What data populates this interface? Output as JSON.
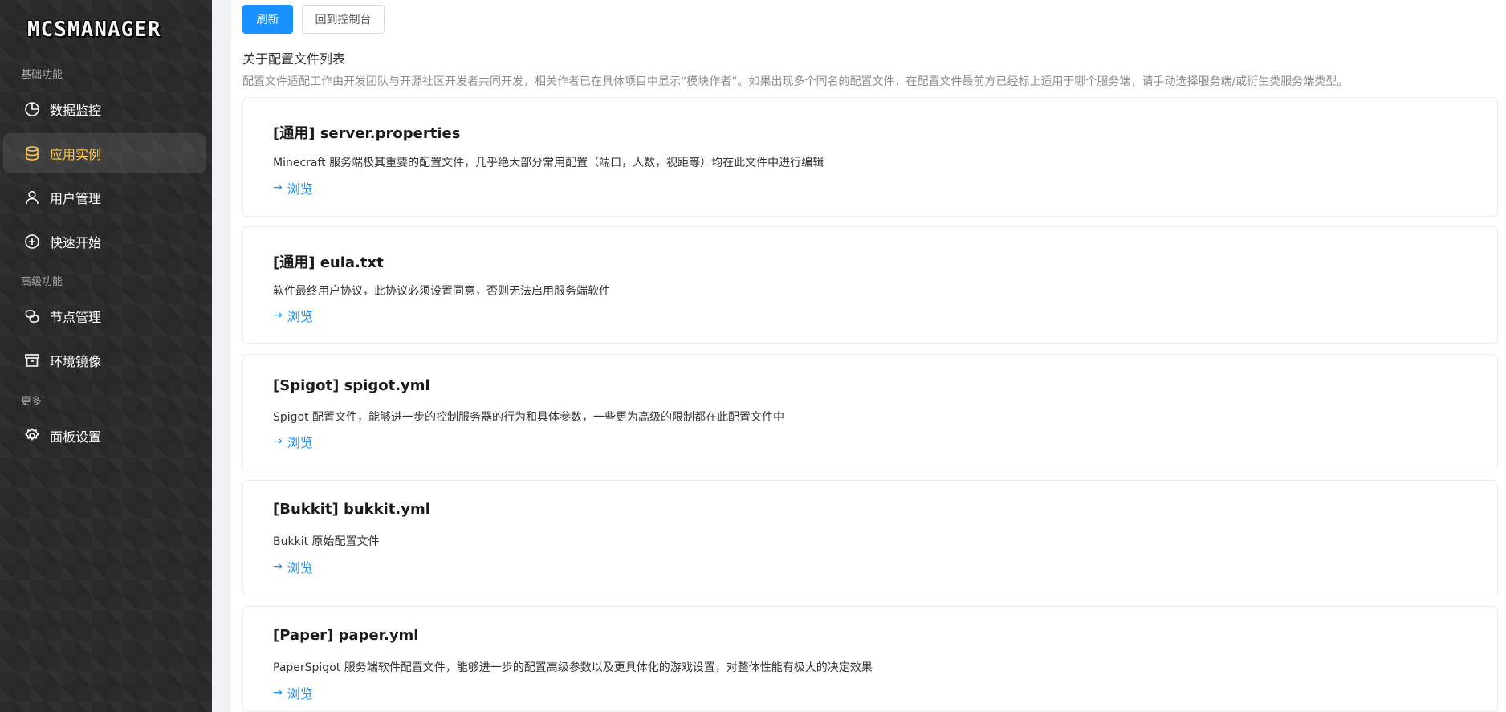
{
  "sidebar": {
    "logo": "MCSMANAGER",
    "groups": [
      {
        "label": "基础功能"
      },
      {
        "label": "高级功能"
      },
      {
        "label": "更多"
      }
    ],
    "items": [
      {
        "label": "数据监控",
        "icon": "pie-chart-icon"
      },
      {
        "label": "应用实例",
        "icon": "database-icon",
        "active": true
      },
      {
        "label": "用户管理",
        "icon": "user-icon"
      },
      {
        "label": "快速开始",
        "icon": "plus-circle-icon"
      },
      {
        "label": "节点管理",
        "icon": "node-icon"
      },
      {
        "label": "环境镜像",
        "icon": "archive-icon"
      },
      {
        "label": "面板设置",
        "icon": "gear-icon"
      }
    ]
  },
  "toolbar": {
    "refresh_label": "刷新",
    "back_label": "回到控制台"
  },
  "section": {
    "title": "关于配置文件列表",
    "description": "配置文件适配工作由开发团队与开源社区开发者共同开发，相关作者已在具体项目中显示“模块作者”。如果出现多个同名的配置文件，在配置文件最前方已经标上适用于哪个服务端，请手动选择服务端/或衍生类服务端类型。"
  },
  "cards": [
    {
      "title": "[通用] server.properties",
      "description": "Minecraft 服务端极其重要的配置文件，几乎绝大部分常用配置（端口，人数，视距等）均在此文件中进行编辑",
      "link": "浏览"
    },
    {
      "title": "[通用] eula.txt",
      "description": "软件最终用户协议，此协议必须设置同意，否则无法启用服务端软件",
      "link": "浏览"
    },
    {
      "title": "[Spigot] spigot.yml",
      "description": "Spigot 配置文件，能够进一步的控制服务器的行为和具体参数，一些更为高级的限制都在此配置文件中",
      "link": "浏览"
    },
    {
      "title": "[Bukkit] bukkit.yml",
      "description": "Bukkit 原始配置文件",
      "link": "浏览"
    },
    {
      "title": "[Paper] paper.yml",
      "description": "PaperSpigot 服务端软件配置文件，能够进一步的配置高级参数以及更具体化的游戏设置，对整体性能有极大的决定效果",
      "link": "浏览"
    }
  ],
  "colors": {
    "accent": "#1890ff",
    "active_nav": "#ffc94a",
    "sidebar_bg": "#2b2b2b"
  }
}
